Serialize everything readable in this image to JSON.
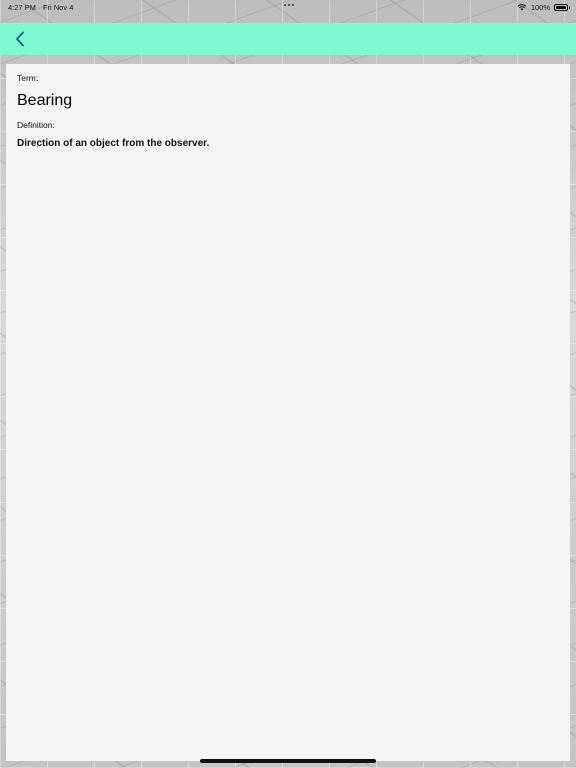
{
  "status_bar": {
    "time": "4:27 PM",
    "date": "Fri Nov 4",
    "battery": "100%",
    "wifi_icon": "wifi-icon",
    "battery_icon": "battery-icon"
  },
  "nav": {
    "back_icon": "chevron-left-icon",
    "accent_color": "#7dfad2"
  },
  "card": {
    "term_label": "Term:",
    "term": "Bearing",
    "definition_label": "Definition:",
    "definition": "Direction of an object from the observer."
  }
}
